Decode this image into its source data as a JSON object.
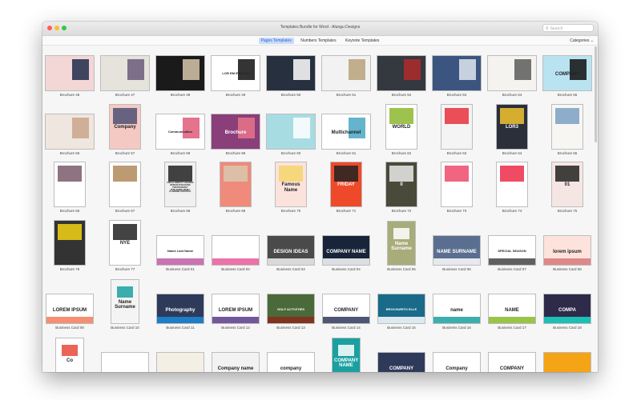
{
  "window": {
    "title": "Templates Bundle for Word - Alungu Designs",
    "search_placeholder": "Search",
    "categories_label": "Categories ⌄"
  },
  "tabs": [
    {
      "label": "Pages Templates",
      "active": true
    },
    {
      "label": "Numbers Templates",
      "active": false
    },
    {
      "label": "Keynote Templates",
      "active": false
    }
  ],
  "rows": [
    {
      "items": [
        {
          "label": "Brochure 46",
          "shape": "land",
          "bg": "#f3d6d6",
          "accent": "#1e2b4a",
          "text": ""
        },
        {
          "label": "Brochure 47",
          "shape": "land",
          "bg": "#e6e2dc",
          "accent": "#6a5a7a",
          "text": ""
        },
        {
          "label": "Brochure 48",
          "shape": "land",
          "bg": "#1a1a1a",
          "accent": "#d8c8ac",
          "text": ""
        },
        {
          "label": "Brochure 49",
          "shape": "land",
          "bg": "#ffffff",
          "accent": "#111111",
          "text": "LOR EM IPSU DO"
        },
        {
          "label": "Brochure 50",
          "shape": "land",
          "bg": "#27303f",
          "accent": "#ffffff",
          "text": ""
        },
        {
          "label": "Brochure 51",
          "shape": "land",
          "bg": "#f2f2f2",
          "accent": "#b9a27a",
          "text": ""
        },
        {
          "label": "Brochure 52",
          "shape": "land",
          "bg": "#34383f",
          "accent": "#b02a2a",
          "text": ""
        },
        {
          "label": "Brochure 53",
          "shape": "land",
          "bg": "#3c5580",
          "accent": "#dfe6ef",
          "text": ""
        },
        {
          "label": "Brochure 54",
          "shape": "land",
          "bg": "#f5f3ef",
          "accent": "#5b5b5b",
          "text": ""
        },
        {
          "label": "Brochure 55",
          "shape": "land",
          "bg": "#b9e3f1",
          "accent": "#111111",
          "text": "COMPANY"
        }
      ]
    },
    {
      "items": [
        {
          "label": "Brochure 56",
          "shape": "land",
          "bg": "#efe6df",
          "accent": "#c9a58c",
          "text": ""
        },
        {
          "label": "Brochure 57",
          "shape": "port",
          "bg": "#f4c9c4",
          "accent": "#4d5074",
          "text": "Company"
        },
        {
          "label": "Brochure 58",
          "shape": "land",
          "bg": "#ffffff",
          "accent": "#e05a7a",
          "text": "Communication"
        },
        {
          "label": "Brochure 59",
          "shape": "land",
          "bg": "#8a3f7a",
          "accent": "#e8748a",
          "text": "Brochure"
        },
        {
          "label": "Brochure 60",
          "shape": "land",
          "bg": "#a8dce3",
          "accent": "#ffffff",
          "text": ""
        },
        {
          "label": "Brochure 61",
          "shape": "land",
          "bg": "#ffffff",
          "accent": "#4aa7c4",
          "text": "Multichannel"
        },
        {
          "label": "Brochure 62",
          "shape": "port",
          "bg": "#ffffff",
          "accent": "#8cb82d",
          "text": "WORLD"
        },
        {
          "label": "Brochure 63",
          "shape": "port",
          "bg": "#f4f4f4",
          "accent": "#e8303a",
          "text": ""
        },
        {
          "label": "Brochure 64",
          "shape": "port",
          "bg": "#2b2f3a",
          "accent": "#f2c430",
          "text": "LOR3"
        },
        {
          "label": "Brochure 65",
          "shape": "port",
          "bg": "#f8f6f2",
          "accent": "#7aa0c4",
          "text": ""
        }
      ]
    },
    {
      "items": [
        {
          "label": "Brochure 66",
          "shape": "port",
          "bg": "#ffffff",
          "accent": "#7a5a6a",
          "text": ""
        },
        {
          "label": "Brochure 67",
          "shape": "port",
          "bg": "#ffffff",
          "accent": "#b08a5a",
          "text": ""
        },
        {
          "label": "Brochure 68",
          "shape": "port",
          "bg": "#f0f0f0",
          "accent": "#222222",
          "text": "VISUAL IDENTITY GRAPHIC DESIGN PACKAGING PHOTOGRAPHY PUBLISHING MEDIA PLANNING STRATEGY"
        },
        {
          "label": "Brochure 69",
          "shape": "port",
          "bg": "#f08a7a",
          "accent": "#d9c7ae",
          "text": ""
        },
        {
          "label": "Brochure 70",
          "shape": "port",
          "bg": "#fbe3dc",
          "accent": "#f5d56a",
          "text": "Famous Name"
        },
        {
          "label": "Brochure 71",
          "shape": "port",
          "bg": "#ee4a2a",
          "accent": "#222222",
          "text": "FRIDAY"
        },
        {
          "label": "Brochure 72",
          "shape": "port",
          "bg": "#4a4a3a",
          "accent": "#e9e9e9",
          "text": "0"
        },
        {
          "label": "Brochure 73",
          "shape": "port",
          "bg": "#ffffff",
          "accent": "#ef4a6a",
          "text": ""
        },
        {
          "label": "Brochure 74",
          "shape": "port",
          "bg": "#ffffff",
          "accent": "#ef2a4a",
          "text": ""
        },
        {
          "label": "Brochure 75",
          "shape": "port",
          "bg": "#f6e6e3",
          "accent": "#222222",
          "text": "01"
        }
      ]
    },
    {
      "items": [
        {
          "label": "Brochure 76",
          "shape": "port",
          "bg": "#333333",
          "accent": "#f5d415",
          "text": ""
        },
        {
          "label": "Brochure 77",
          "shape": "port",
          "bg": "#ffffff",
          "accent": "#222222",
          "text": "NYE"
        },
        {
          "label": "Business Card 01",
          "shape": "card",
          "bg": "#ffffff",
          "accent": "#c05aa5",
          "text": "Name Last Name"
        },
        {
          "label": "Business Card 02",
          "shape": "card",
          "bg": "#ffffff",
          "accent": "#e65a9a",
          "text": ""
        },
        {
          "label": "Business Card 03",
          "shape": "card",
          "bg": "#4a4a4a",
          "accent": "#f2f2f2",
          "text": "DESIGN IDEAS"
        },
        {
          "label": "Business Card 04",
          "shape": "card",
          "bg": "#18243a",
          "accent": "#ffffff",
          "text": "COMPANY NAME"
        },
        {
          "label": "Business Card 05",
          "shape": "vcard",
          "bg": "#a8ac7a",
          "accent": "#ffffff",
          "text": "Name Surname"
        },
        {
          "label": "Business Card 06",
          "shape": "card",
          "bg": "#5a6f90",
          "accent": "#ffffff",
          "text": "NAME SURNAME"
        },
        {
          "label": "Business Card 07",
          "shape": "card",
          "bg": "#ffffff",
          "accent": "#444444",
          "text": "SPECIAL SEASON"
        },
        {
          "label": "Business Card 08",
          "shape": "card",
          "bg": "#fde3dc",
          "accent": "#d9787a",
          "text": "lorem ipsum"
        }
      ]
    },
    {
      "items": [
        {
          "label": "Business Card 09",
          "shape": "card",
          "bg": "#ffffff",
          "accent": "#f47a5a",
          "text": "LOREM IPSUM"
        },
        {
          "label": "Business Card 10",
          "shape": "vcard",
          "bg": "#f4f4f4",
          "accent": "#1aa0a0",
          "text": "Name Surname"
        },
        {
          "label": "Business Card 11",
          "shape": "card",
          "bg": "#2e3a5a",
          "accent": "#1c8ad8",
          "text": "Photography"
        },
        {
          "label": "Business Card 12",
          "shape": "card",
          "bg": "#ffffff",
          "accent": "#5a3a8a",
          "text": "LOREM IPSUM"
        },
        {
          "label": "Business Card 13",
          "shape": "card",
          "bg": "#4a6a3a",
          "accent": "#8a2a1a",
          "text": "GOLF ACTIVITIES"
        },
        {
          "label": "Business Card 14",
          "shape": "card",
          "bg": "#ffffff",
          "accent": "#2e3a5a",
          "text": "COMPANY"
        },
        {
          "label": "Business Card 15",
          "shape": "card",
          "bg": "#1a6a8a",
          "accent": "#ffffff",
          "text": "BROCHURITO ELLE"
        },
        {
          "label": "Business Card 16",
          "shape": "card",
          "bg": "#ffffff",
          "accent": "#1aa0a0",
          "text": "name"
        },
        {
          "label": "Business Card 17",
          "shape": "card",
          "bg": "#ffffff",
          "accent": "#8ab82a",
          "text": "NAME"
        },
        {
          "label": "Business Card 18",
          "shape": "card",
          "bg": "#2e2a4a",
          "accent": "#1ad8c8",
          "text": "COMPA"
        }
      ]
    },
    {
      "items": [
        {
          "label": "",
          "shape": "vcard",
          "bg": "#ffffff",
          "accent": "#e84a3a",
          "text": "Co"
        },
        {
          "label": "",
          "shape": "card",
          "bg": "#ffffff",
          "accent": "#111111",
          "text": ""
        },
        {
          "label": "",
          "shape": "card",
          "bg": "#f4efe4",
          "accent": "#6a4a3a",
          "text": ""
        },
        {
          "label": "",
          "shape": "card",
          "bg": "#f2f2f2",
          "accent": "#888888",
          "text": "Company name"
        },
        {
          "label": "",
          "shape": "card",
          "bg": "#ffffff",
          "accent": "#f5c415",
          "text": "company"
        },
        {
          "label": "",
          "shape": "vcard",
          "bg": "#1aa0a0",
          "accent": "#ffffff",
          "text": "COMPANY NAME"
        },
        {
          "label": "",
          "shape": "card",
          "bg": "#2e3a5a",
          "accent": "#e8303a",
          "text": "COMPANY"
        },
        {
          "label": "",
          "shape": "card",
          "bg": "#ffffff",
          "accent": "#1aa0a0",
          "text": "Company"
        },
        {
          "label": "",
          "shape": "card",
          "bg": "#ffffff",
          "accent": "#1a2a4a",
          "text": "COMPANY"
        },
        {
          "label": "",
          "shape": "card",
          "bg": "#f5a415",
          "accent": "#ffffff",
          "text": ""
        }
      ]
    }
  ]
}
